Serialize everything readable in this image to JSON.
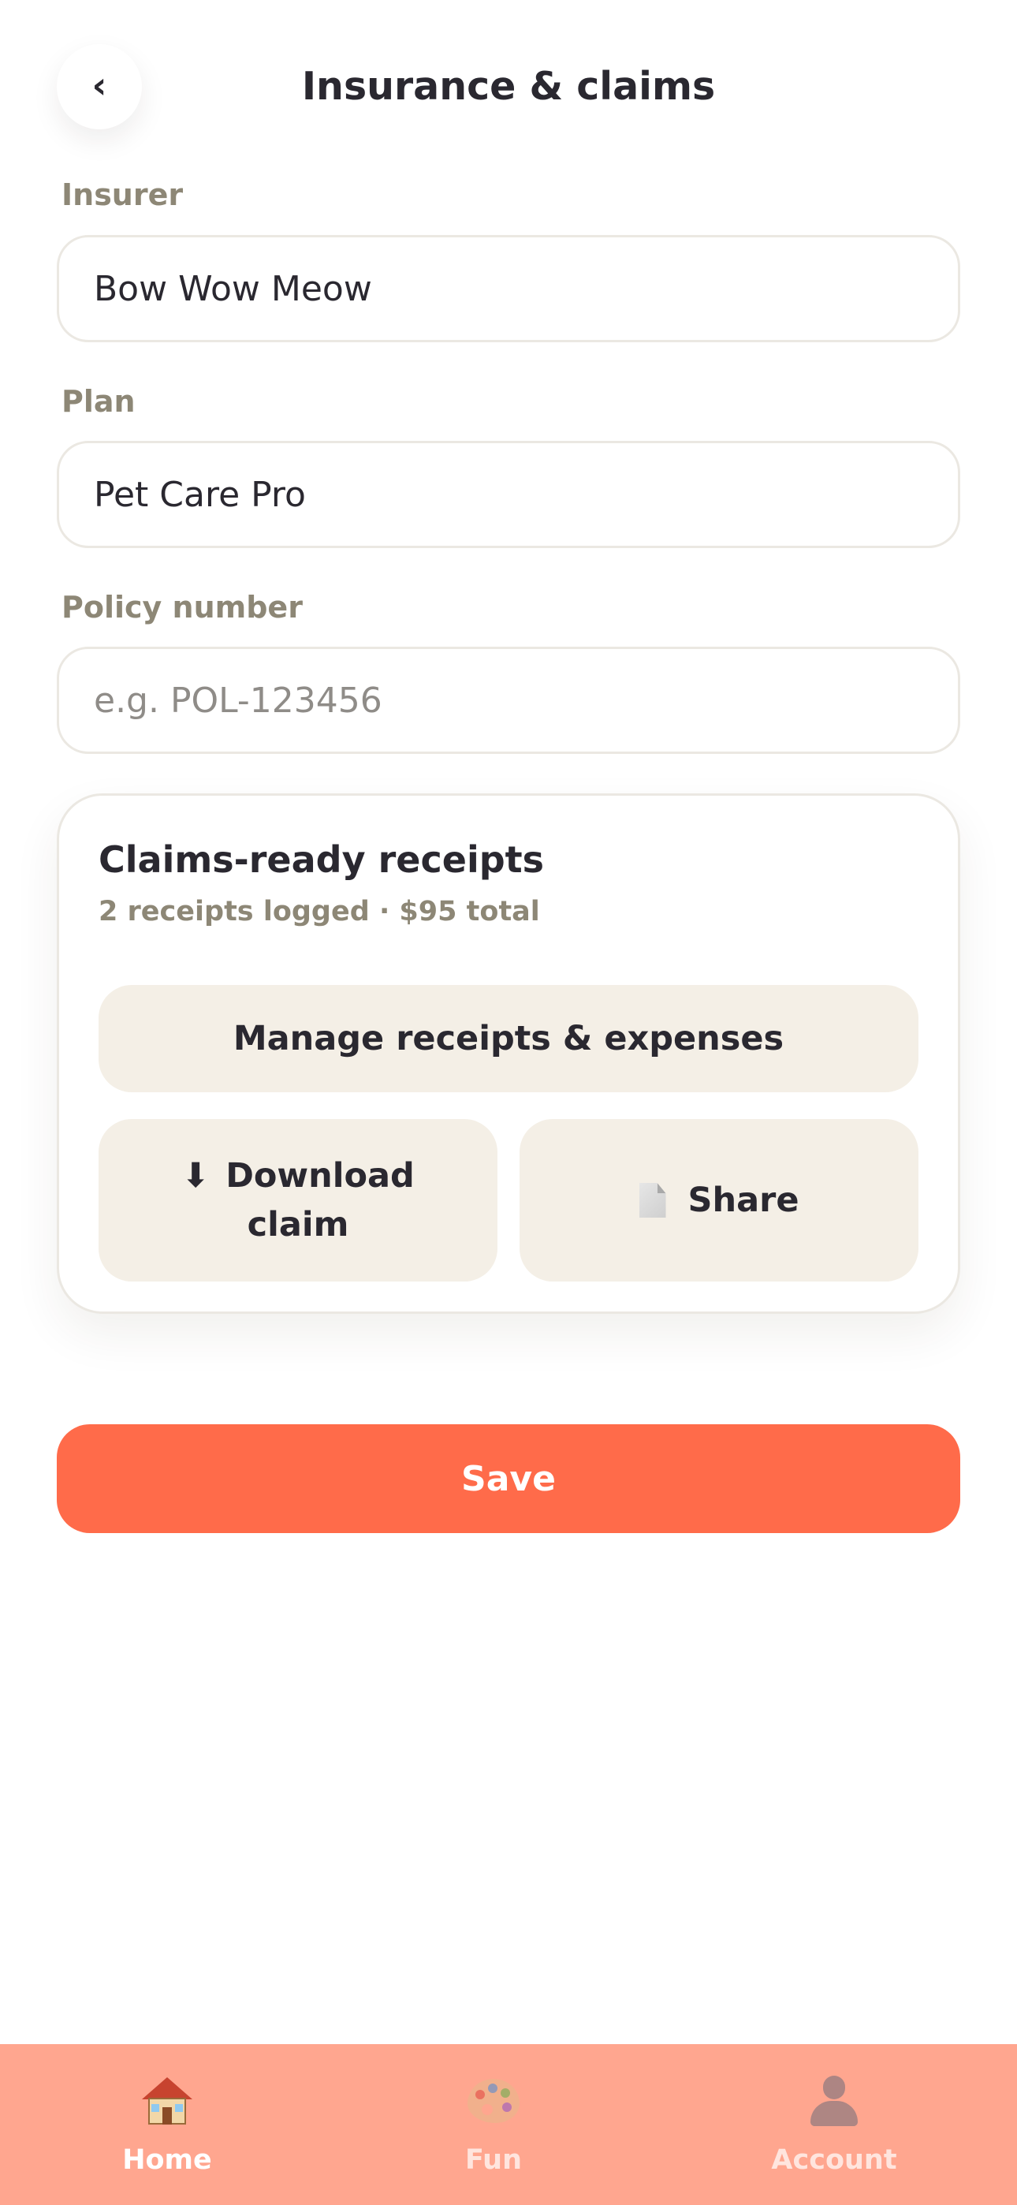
{
  "header": {
    "back_glyph": "‹",
    "title": "Insurance & claims"
  },
  "form": {
    "insurer": {
      "label": "Insurer",
      "value": "Bow Wow Meow"
    },
    "plan": {
      "label": "Plan",
      "value": "Pet Care Pro"
    },
    "policy_number": {
      "label": "Policy number",
      "value": "",
      "placeholder": "e.g. POL-123456"
    }
  },
  "claims": {
    "title": "Claims-ready receipts",
    "summary": "2 receipts logged · $95 total",
    "manage_label": "Manage receipts & expenses",
    "download_icon": "⬇",
    "download_label": "Download claim",
    "share_label": "Share"
  },
  "save_label": "Save",
  "nav": {
    "items": [
      {
        "label": "Home",
        "icon": "house-icon",
        "active": true
      },
      {
        "label": "Fun",
        "icon": "palette-icon",
        "active": false
      },
      {
        "label": "Account",
        "icon": "person-icon",
        "active": false
      }
    ]
  },
  "colors": {
    "accent": "#ff6b4a",
    "nav_background": "#ffa68f",
    "soft_button": "#f4efe6",
    "label": "#8d8776",
    "text": "#2a2830"
  }
}
